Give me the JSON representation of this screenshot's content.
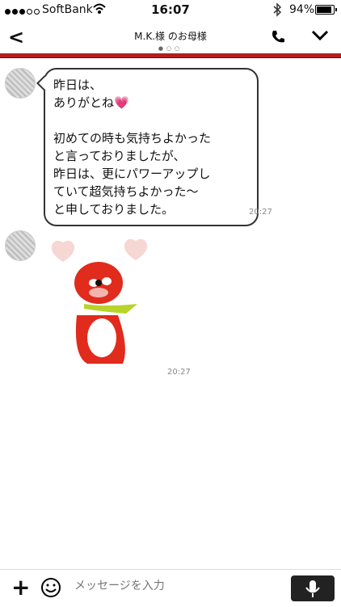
{
  "status": {
    "carrier": "SoftBank",
    "time": "16:07",
    "battery": "94%"
  },
  "header": {
    "title": "M.K.様 のお母様"
  },
  "messages": [
    {
      "type": "text",
      "lines": [
        "昨日は、",
        "ありがとね💗",
        "",
        "初めての時も気持ちよかった",
        "と言っておりましたが、",
        "昨日は、更にパワーアップし",
        "ていて超気持ちよかった〜",
        "と申しておりました。"
      ],
      "time": "20:27"
    },
    {
      "type": "sticker",
      "time": "20:27"
    }
  ],
  "composer": {
    "placeholder": "メッセージを入力"
  },
  "colors": {
    "border": "#b21e1e",
    "sticker": "#e12b1d",
    "scarf": "#b8d32a"
  },
  "icons": [
    "back-icon",
    "phone-icon",
    "chevron-down-icon",
    "plus-icon",
    "smile-icon",
    "mic-icon"
  ]
}
